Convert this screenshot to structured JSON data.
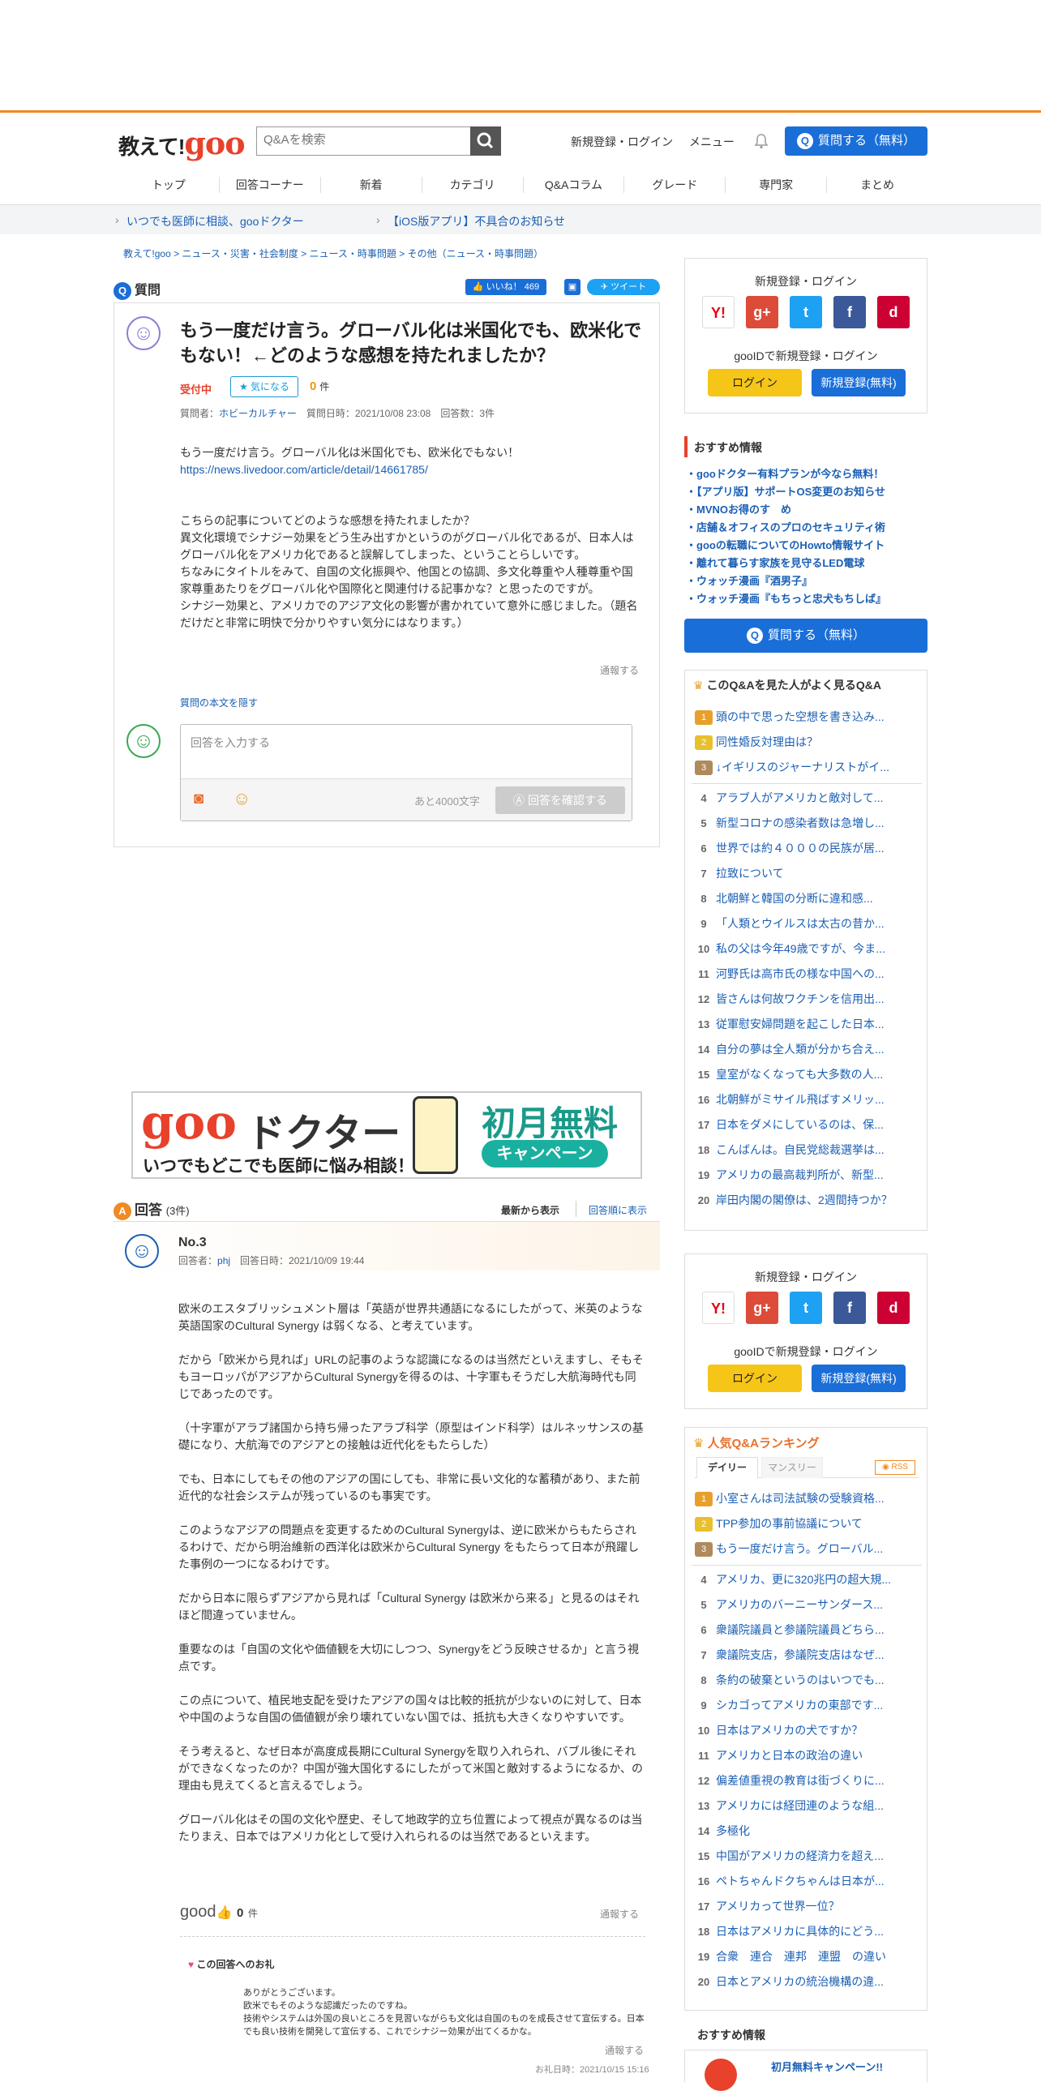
{
  "header": {
    "logo_text": "教えて!",
    "logo_goo": "goo",
    "search_placeholder": "Q&Aを検索",
    "login_link": "新規登録・ログイン",
    "menu_link": "メニュー",
    "ask_label": "質問する（無料）"
  },
  "nav": [
    "トップ",
    "回答コーナー",
    "新着",
    "カテゴリ",
    "Q&Aコラム",
    "グレード",
    "専門家",
    "まとめ"
  ],
  "notices": [
    "いつでも医師に相談、gooドクター",
    "【iOS版アプリ】不具合のお知らせ"
  ],
  "breadcrumb": "教えて!goo >  ニュース・災害・社会制度 >  ニュース・時事問題 >  その他（ニュース・時事問題）",
  "question": {
    "section_label": "質問",
    "like_label": "いいね！ 469",
    "tweet_label": "ツイート",
    "title": "もう一度だけ言う。グローバル化は米国化でも、欧米化でもない！←どのような感想を持たれましたか？",
    "status": "受付中",
    "watch_label": "気になる",
    "count": "0",
    "count_unit": "件",
    "meta_asker_label": "質問者：",
    "asker": "ホビーカルチャー",
    "meta_rest": "質問日時：2021/10/08 23:08　回答数：3件",
    "body1": "もう一度だけ言う。グローバル化は米国化でも、欧米化でもない！",
    "link": "https://news.livedoor.com/article/detail/14661785/",
    "body2": "こちらの記事についてどのような感想を持たれましたか？\n異文化環境でシナジー効果をどう生み出すかというのがグローバル化であるが、日本人はグローバル化をアメリカ化であると誤解してしまった、ということらしいです。\nちなみにタイトルをみて、自国の文化振興や、他国との協調、多文化尊重や人種尊重や国家尊重あたりをグローバル化や国際化と関連付ける記事かな？と思ったのですが。\nシナジー効果と、アメリカでのアジア文化の影響が書かれていて意外に感じました。（題名だけだと非常に明快で分かりやすい気分にはなります。）",
    "report": "通報する",
    "hide_label": "質問の本文を隠す",
    "answer_placeholder": "回答を入力する",
    "chars_left": "あと4000文字",
    "confirm_label": "回答を確認する"
  },
  "ad": {
    "brand": "goo",
    "title": "ドクター",
    "sub": "いつでもどこでも医師に悩み相談！",
    "badge1": "初月無料",
    "badge2": "キャンペーン"
  },
  "answers": {
    "label": "回答",
    "count": "(3件)",
    "sort_new": "最新から表示",
    "sort_old": "回答順に表示",
    "no": "No.3",
    "answerer_label": "回答者：",
    "answerer": "phj",
    "date": "回答日時：2021/10/09 19:44",
    "paragraphs": [
      "欧米のエスタブリッシュメント層は「英語が世界共通語になるにしたがって、米英のような英語国家のCultural Synergy は弱くなる、と考えています。",
      "だから「欧米から見れば」URLの記事のような認識になるのは当然だといえますし、そもそもヨーロッパがアジアからCultural Synergyを得るのは、十字軍もそうだし大航海時代も同じであったのです。",
      "（十字軍がアラブ諸国から持ち帰ったアラブ科学（原型はインド科学）はルネッサンスの基礎になり、大航海でのアジアとの接触は近代化をもたらした）",
      "でも、日本にしてもその他のアジアの国にしても、非常に長い文化的な蓄積があり、また前近代的な社会システムが残っているのも事実です。",
      "このようなアジアの問題点を変更するためのCultural Synergyは、逆に欧米からもたらされるわけで、だから明治維新の西洋化は欧米からCultural Synergy をもたらって日本が飛躍した事例の一つになるわけです。",
      "だから日本に限らずアジアから見れば「Cultural Synergy は欧米から来る」と見るのはそれほど間違っていません。",
      "重要なのは「自国の文化や価値観を大切にしつつ、Synergyをどう反映させるか」と言う視点です。",
      "この点について、植民地支配を受けたアジアの国々は比較的抵抗が少ないのに対して、日本や中国のような自国の価値観が余り壊れていない国では、抵抗も大きくなりやすいです。",
      "そう考えると、なぜ日本が高度成長期にCultural Synergyを取り入れられ、バブル後にそれができなくなったのか？中国が強大国化するにしたがって米国と敵対するようになるか、の理由も見えてくると言えるでしょう。",
      "グローバル化はその国の文化や歴史、そして地政学的立ち位置によって視点が異なるのは当たりまえ、日本ではアメリカ化として受け入れられるのは当然であるといえます。"
    ],
    "good_label": "good",
    "good_count": "0",
    "good_unit": "件",
    "report": "通報する",
    "thanks_title": "この回答へのお礼",
    "thanks_body": "ありがとうございます。\n欧米でもそのような認識だったのですね。\n技術やシステムは外国の良いところを見習いながらも文化は自国のものを成長させて宣伝する。日本でも良い技術を開発して宣伝する、これでシナジー効果が出てくるかな。",
    "thanks_report": "通報する",
    "thanks_date": "お礼日時：2021/10/15 15:16"
  },
  "sidebar": {
    "login_title": "新規登録・ログイン",
    "gooid_text": "gooIDで新規登録・ログイン",
    "login_btn": "ログイン",
    "register_btn": "新規登録(無料)",
    "social": [
      {
        "name": "yahoo",
        "label": "Y!",
        "color": "#ffffff",
        "text": "#e60012"
      },
      {
        "name": "google",
        "label": "g+",
        "color": "#dd4b39",
        "text": "#ffffff"
      },
      {
        "name": "twitter",
        "label": "t",
        "color": "#1da1f2",
        "text": "#ffffff"
      },
      {
        "name": "facebook",
        "label": "f",
        "color": "#3b5998",
        "text": "#ffffff"
      },
      {
        "name": "docomo",
        "label": "d",
        "color": "#cc0033",
        "text": "#ffffff"
      }
    ],
    "rec_title": "おすすめ情報",
    "rec": [
      "・gooドクター有料プランが今なら無料！",
      "・【アプリ版】サポートOS変更のお知らせ",
      "・MVNOお得のす　め",
      "・店舗＆オフィスのプロのセキュリティ術",
      "・gooの転職についてのHowto情報サイト",
      "・離れて暮らす家族を見守るLED電球",
      "・ウォッチ漫画『酒男子』",
      "・ウォッチ漫画『もちっと忠犬もちしば』"
    ],
    "ask_label": "質問する（無料）",
    "related_title": "このQ&Aを見た人がよく見るQ&A",
    "related": [
      "頭の中で思った空想を書き込み...",
      "同性婚反対理由は？",
      "↓イギリスのジャーナリストがイ...",
      "アラブ人がアメリカと敵対して...",
      "新型コロナの感染者数は急増し...",
      "世界では約４０００の民族が居...",
      "拉致について",
      "北朝鮮と韓国の分断に違和感...",
      "「人類とウイルスは太古の昔か...",
      "私の父は今年49歳ですが、今ま...",
      "河野氏は高市氏の様な中国への...",
      "皆さんは何故ワクチンを信用出...",
      "従軍慰安婦問題を起こした日本...",
      "自分の夢は全人類が分かち合え...",
      "皇室がなくなっても大多数の人...",
      "北朝鮮がミサイル飛ばすメリッ...",
      "日本をダメにしているのは、保...",
      "こんばんは。自民党総裁選挙は...",
      "アメリカの最高裁判所が、新型...",
      "岸田内閣の閣僚は、2週間持つか？"
    ],
    "rank_title": "人気Q&Aランキング",
    "tab_daily": "デイリー",
    "tab_monthly": "マンスリー",
    "rss": "RSS",
    "ranking": [
      "小室さんは司法試験の受験資格...",
      "TPP参加の事前協議について",
      "もう一度だけ言う。グローバル...",
      "アメリカ、更に320兆円の超大規...",
      "アメリカのバーニーサンダース...",
      "衆議院議員と参議院議員どちら...",
      "衆議院支店，参議院支店はなぜ...",
      "条約の破棄というのはいつでも...",
      "シカゴってアメリカの東部です...",
      "日本はアメリカの犬ですか？",
      "アメリカと日本の政治の違い",
      "偏差値重視の教育は街づくりに...",
      "アメリカには経団連のような組...",
      "多極化",
      "中国がアメリカの経済力を超え...",
      "ペトちゃんドクちゃんは日本が...",
      "アメリカって世界一位？",
      "日本はアメリカに具体的にどう...",
      "合衆　連合　連邦　連盟　の違い",
      "日本とアメリカの統治機構の違..."
    ],
    "rec2_title": "おすすめ情報",
    "rec2_item": "初月無料キャンペーン!!"
  }
}
